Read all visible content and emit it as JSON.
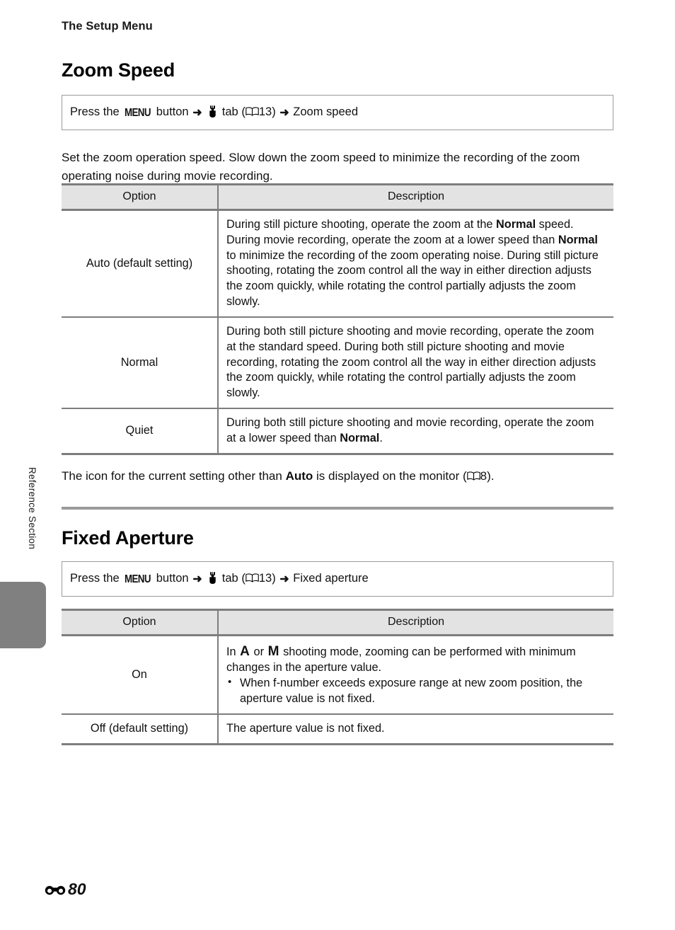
{
  "page": {
    "running_head": "The Setup Menu",
    "folio_mark_icon": "reference-section-mark-icon",
    "folio_number": "80",
    "side_label": "Reference Section"
  },
  "sections": [
    {
      "id": "zoom-speed",
      "title": "Zoom Speed",
      "menu_path": {
        "prefix": "Press the",
        "menu_button_label": "MENU",
        "button_word": "button",
        "arrow": "➜",
        "wrench_icon": "wrench-setup-tab-icon",
        "tab_word": "tab",
        "open_paren": "(",
        "book_icon": "book-page-reference-icon",
        "page_ref": "13",
        "close_paren": ")",
        "target": "Zoom speed"
      },
      "intro": "Set the zoom operation speed. Slow down the zoom speed to minimize the recording of the zoom operating noise during movie recording.",
      "table": {
        "headers": [
          "Option",
          "Description"
        ],
        "rows": [
          {
            "option": "Auto (default setting)",
            "description_parts": [
              {
                "t": "During still picture shooting, operate the zoom at the ",
                "b": false
              },
              {
                "t": "Normal",
                "b": true
              },
              {
                "t": " speed. During movie recording, operate the zoom at a lower speed than ",
                "b": false
              },
              {
                "t": "Normal",
                "b": true
              },
              {
                "t": " to minimize the recording of the zoom operating noise. During still picture shooting, rotating the zoom control all the way in either direction adjusts the zoom quickly, while rotating the control partially adjusts the zoom slowly.",
                "b": false
              }
            ]
          },
          {
            "option": "Normal",
            "description_parts": [
              {
                "t": "During both still picture shooting and movie recording, operate the zoom at the standard speed. During both still picture shooting and movie recording, rotating the zoom control all the way in either direction adjusts the zoom quickly, while rotating the control partially adjusts the zoom slowly.",
                "b": false
              }
            ]
          },
          {
            "option": "Quiet",
            "description_parts": [
              {
                "t": "During both still picture shooting and movie recording, operate the zoom at a lower speed than ",
                "b": false
              },
              {
                "t": "Normal",
                "b": true
              },
              {
                "t": ".",
                "b": false
              }
            ]
          }
        ]
      },
      "note_parts": [
        {
          "t": "The icon for the current setting other than ",
          "b": false
        },
        {
          "t": "Auto",
          "b": true
        },
        {
          "t": " is displayed on the monitor (",
          "b": false
        },
        {
          "icon": "book-page-reference-icon"
        },
        {
          "t": "8).",
          "b": false
        }
      ]
    },
    {
      "id": "fixed-aperture",
      "title": "Fixed Aperture",
      "menu_path": {
        "prefix": "Press the",
        "menu_button_label": "MENU",
        "button_word": "button",
        "arrow": "➜",
        "wrench_icon": "wrench-setup-tab-icon",
        "tab_word": "tab",
        "open_paren": "(",
        "book_icon": "book-page-reference-icon",
        "page_ref": "13",
        "close_paren": ")",
        "target": "Fixed aperture"
      },
      "table": {
        "headers": [
          "Option",
          "Description"
        ],
        "rows": [
          {
            "option": "On",
            "lead_parts": [
              {
                "t": "In ",
                "b": false
              },
              {
                "glyph": "A"
              },
              {
                "t": " or ",
                "b": false
              },
              {
                "glyph": "M"
              },
              {
                "t": " shooting mode, zooming can be performed with minimum changes in the aperture value.",
                "b": false
              }
            ],
            "bullets": [
              "When f-number exceeds exposure range at new zoom position, the aperture value is not fixed."
            ]
          },
          {
            "option": "Off (default setting)",
            "lead_parts": [
              {
                "t": "The aperture value is not fixed.",
                "b": false
              }
            ],
            "bullets": []
          }
        ]
      }
    }
  ],
  "colors": {
    "table_header_bg": "#e3e3e3",
    "rule": "#7d7d7d",
    "side_tab": "#808080",
    "divider": "#9a9a9a",
    "text": "#111111"
  }
}
